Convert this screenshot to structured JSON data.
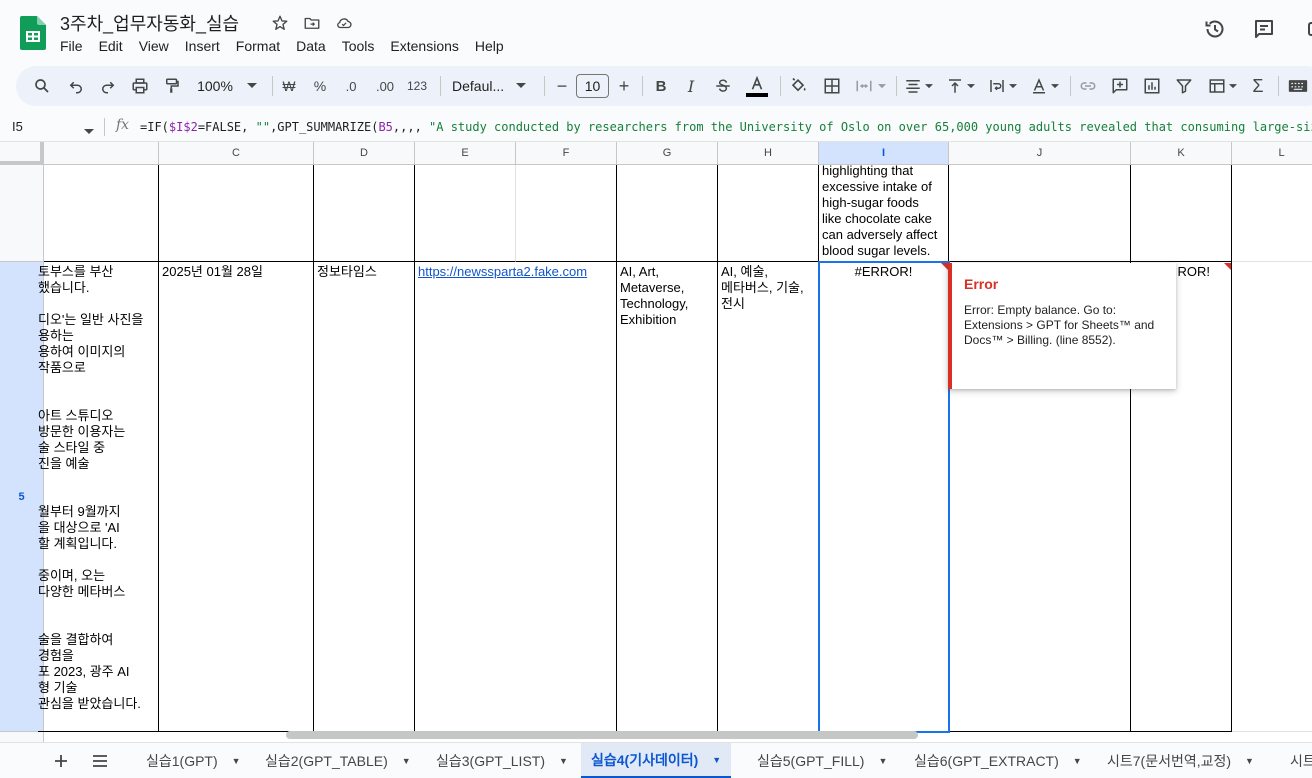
{
  "doc": {
    "title": "3주차_업무자동화_실습",
    "menu": [
      "File",
      "Edit",
      "View",
      "Insert",
      "Format",
      "Data",
      "Tools",
      "Extensions",
      "Help"
    ]
  },
  "toolbar": {
    "zoom": "100%",
    "currency": "₩",
    "percent": "%",
    "dec_decrease": ".0",
    "dec_increase": ".00",
    "number_format": "123",
    "font": "Defaul...",
    "font_size": "10",
    "minus": "−",
    "plus": "+",
    "bold": "B",
    "italic": "I",
    "sigma": "Σ"
  },
  "formula_bar": {
    "cell_ref": "I5",
    "fx": "fx",
    "formula_parts": [
      "=IF(",
      "$I$2",
      "=FALSE, ",
      "\"\"",
      ",GPT_SUMMARIZE(",
      "B5",
      ",,,, ",
      "\"A study conducted by researchers from the University of Oslo on over 65,000 young adults revealed that consuming large-siz"
    ]
  },
  "grid": {
    "columns": [
      "C",
      "D",
      "E",
      "F",
      "G",
      "H",
      "I",
      "J",
      "K",
      "L"
    ],
    "selected_column": "I",
    "selected_row": "5",
    "row4": {
      "I": "highlighting that\nexcessive intake of\nhigh-sugar foods\nlike chocolate cake\ncan adversely affect\nblood sugar levels."
    },
    "row5": {
      "B": "토부스를 부산\n했습니다.\n\n디오'는 일반 사진을\n용하는\n용하여 이미지의\n 작품으로\n\n\n 아트 스튜디오\n방문한 이용자는\n술 스타일 중\n진을 예술\n\n\n월부터 9월까지\n을 대상으로 'AI\n할 계획입니다.\n\n중이며, 오는\n다양한 메타버스\n\n\n술을 결합하여\n 경험을\n포 2023, 광주 AI\n형 기술\n관심을 받았습니다.",
      "C": "2025년 01월 28일",
      "D": "정보타임스",
      "E": "https://newssparta2.fake.com",
      "G": "AI, Art,\nMetaverse,\nTechnology,\nExhibition",
      "H": "AI, 예술,\n메타버스, 기술,\n전시",
      "I": "#ERROR!",
      "K": "ROR!"
    }
  },
  "error_popup": {
    "title": "Error",
    "message": "Error: Empty balance. Go to: Extensions > GPT for Sheets™ and Docs™ > Billing. (line 8552)."
  },
  "sheets": {
    "tabs": [
      {
        "label": "실습1(GPT)",
        "active": false
      },
      {
        "label": "실습2(GPT_TABLE)",
        "active": false
      },
      {
        "label": "실습3(GPT_LIST)",
        "active": false
      },
      {
        "label": "실습4(기사데이터)",
        "active": true
      },
      {
        "label": "실습5(GPT_FILL)",
        "active": false
      },
      {
        "label": "실습6(GPT_EXTRACT)",
        "active": false
      },
      {
        "label": "시트7(문서번역,교정)",
        "active": false
      },
      {
        "label": "시트",
        "active": false
      }
    ]
  },
  "colors": {
    "accent": "#0b57d0",
    "selection_border": "#1a73e8",
    "error": "#d93025",
    "link": "#1155cc",
    "logo_green": "#0f9d58"
  }
}
